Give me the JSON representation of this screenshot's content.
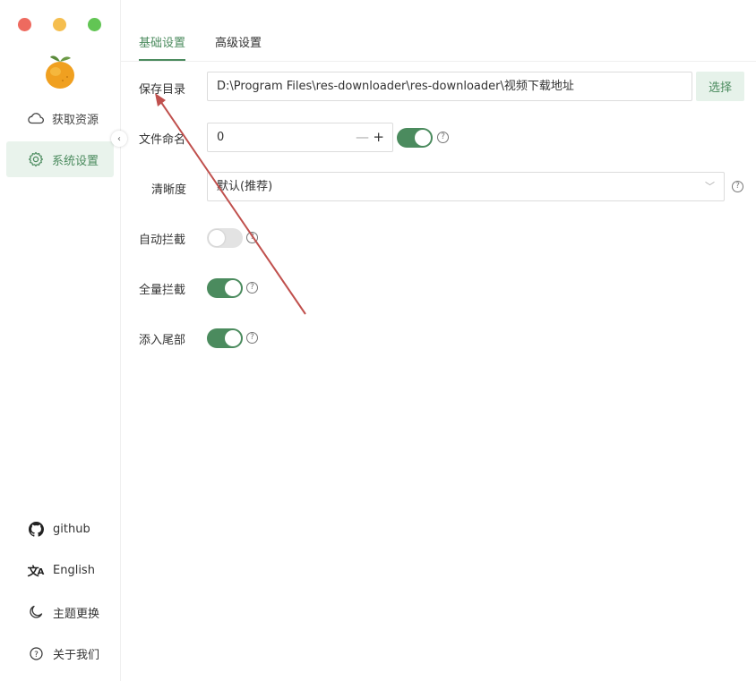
{
  "sidebar": {
    "nav": [
      {
        "label": "获取资源",
        "icon": "cloud-icon"
      },
      {
        "label": "系统设置",
        "icon": "gear-icon"
      }
    ],
    "bottom": [
      {
        "label": "github",
        "icon": "github-icon"
      },
      {
        "label": "English",
        "icon": "translate-icon"
      },
      {
        "label": "主题更换",
        "icon": "moon-icon"
      },
      {
        "label": "关于我们",
        "icon": "help-circle-icon"
      }
    ],
    "collapse_glyph": "‹"
  },
  "tabs": [
    {
      "label": "基础设置",
      "active": true
    },
    {
      "label": "高级设置",
      "active": false
    }
  ],
  "settings": {
    "save_dir": {
      "label": "保存目录",
      "value": "D:\\Program Files\\res-downloader\\res-downloader\\视频下载地址",
      "button": "选择"
    },
    "file_naming": {
      "label": "文件命名",
      "value": "0",
      "minus": "—",
      "plus": "+",
      "toggle_on": true
    },
    "quality": {
      "label": "清晰度",
      "value": "默认(推荐)"
    },
    "auto_intercept": {
      "label": "自动拦截",
      "on": false
    },
    "full_intercept": {
      "label": "全量拦截",
      "on": true
    },
    "append_tail": {
      "label": "添入尾部",
      "on": true
    }
  },
  "help_glyph": "?",
  "colors": {
    "accent": "#4b8b5e",
    "accent_bg": "#e9f3ec",
    "traffic_red": "#ee6a5f",
    "traffic_yellow": "#f5be4f",
    "traffic_green": "#62c554",
    "annotation_arrow": "#c0504d"
  }
}
